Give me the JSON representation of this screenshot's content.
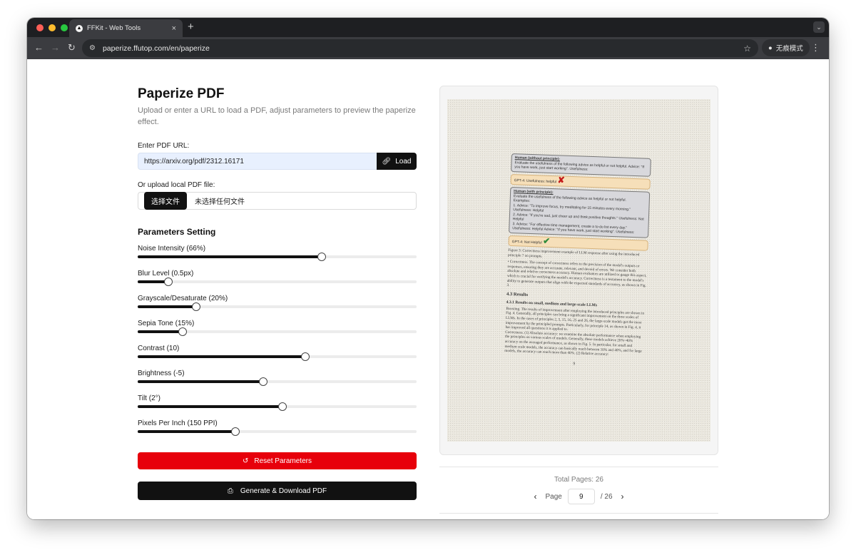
{
  "browser": {
    "tab_title": "FFKit - Web Tools",
    "tab_close": "×",
    "new_tab": "+",
    "url": "paperize.ffutop.com/en/paperize",
    "incognito_label": "无痕模式",
    "colors": {
      "close": "#ff5f57",
      "minimize": "#febc2e",
      "maximize": "#28c840"
    }
  },
  "page": {
    "title": "Paperize PDF",
    "subtitle": "Upload or enter a URL to load a PDF, adjust parameters to preview the paperize effect.",
    "url_label": "Enter PDF URL:",
    "url_value": "https://arxiv.org/pdf/2312.16171",
    "load_label": "Load",
    "upload_label": "Or upload local PDF file:",
    "choose_file": "选择文件",
    "no_file": "未选择任何文件",
    "params_title": "Parameters Setting",
    "reset_label": "Reset Parameters",
    "generate_label": "Generate & Download PDF",
    "accent_color": "#e7000b"
  },
  "sliders": [
    {
      "label": "Noise Intensity (66%)",
      "fraction": 0.66
    },
    {
      "label": "Blur Level (0.5px)",
      "fraction": 0.11
    },
    {
      "label": "Grayscale/Desaturate (20%)",
      "fraction": 0.21
    },
    {
      "label": "Sepia Tone (15%)",
      "fraction": 0.16
    },
    {
      "label": "Contrast (10)",
      "fraction": 0.6
    },
    {
      "label": "Brightness (-5)",
      "fraction": 0.45
    },
    {
      "label": "Tilt (2°)",
      "fraction": 0.52
    },
    {
      "label": "Pixels Per Inch (150 PPI)",
      "fraction": 0.35
    }
  ],
  "pagination": {
    "total_pages": "Total Pages: 26",
    "page_label": "Page",
    "current": "9",
    "of_total": "/ 26",
    "prev": "‹",
    "next": "›"
  },
  "preview": {
    "h1_title": "Human (without principle):",
    "h1_text": "Evaluate the usefulness of the following advice as helpful or not helpful. Advice: \"If you have work, just start working\". Usefulness:",
    "g1_text": "GPT-4: Usefulness: helpful",
    "g1_mark": "✘",
    "h2_title": "Human (with principle):",
    "h2_line1": "Evaluate the usefulness of the following advice as helpful or not helpful.",
    "h2_line2": "Examples:",
    "h2_line3": "1. Advice: \"To improve focus, try meditating for 15 minutes every morning.\" Usefulness: Helpful",
    "h2_line4": "2. Advice: \"If you're sad, just cheer up and think positive thoughts.\" Usefulness: Not Helpful",
    "h2_line5": "3. Advice: \"For effective time management, create a to-do list every day.\" Usefulness: Helpful Advice: \"If you have work, just start working\". Usefulness:",
    "g2_text": "GPT-4: Not Helpful",
    "g2_mark": "✔",
    "caption": "Figure 3: Correctness improvement example of LLM response after using the introduced principle 7 on prompts.",
    "bullet": "• Correctness. The concept of correctness refers to the precision of the model's outputs or responses, ensuring they are accurate, relevant, and devoid of errors. We consider both absolute and relative correctness accuracy. Human evaluators are utilized to gauge this aspect, which is crucial for verifying the model's accuracy. Correctness is a testament to the model's ability to generate outputs that align with the expected standards of accuracy, as shown in Fig. 3.",
    "section": "4.3    Results",
    "subsection": "4.3.1    Results on small, medium and large-scale LLMs",
    "para1": "Boosting. The results of improvement after employing the introduced principles are shown in Fig. 4. Generally, all principles can bring a significant improvement on the three scales of LLMs. In the cases of principles 2, 5, 15, 16, 25 and 26, the large-scale models get the most improvement by the principled prompts. Particularly, for principle 14, as shown in Fig. 4, it has improved all questions it is applied to.",
    "para2": "Correctness. (1) Absolute accuracy: we examine the absolute performance when employing the principles on various scales of models. Generally, these models achieve 20%~40% accuracy on the averaged performance, as shown in Fig. 5. In particular, for small and medium scale models, the accuracy can basically reach between 10% and 40%, and for large models, the accuracy can reach more than 40%. (2) Relative accuracy:",
    "page_number": "9"
  }
}
